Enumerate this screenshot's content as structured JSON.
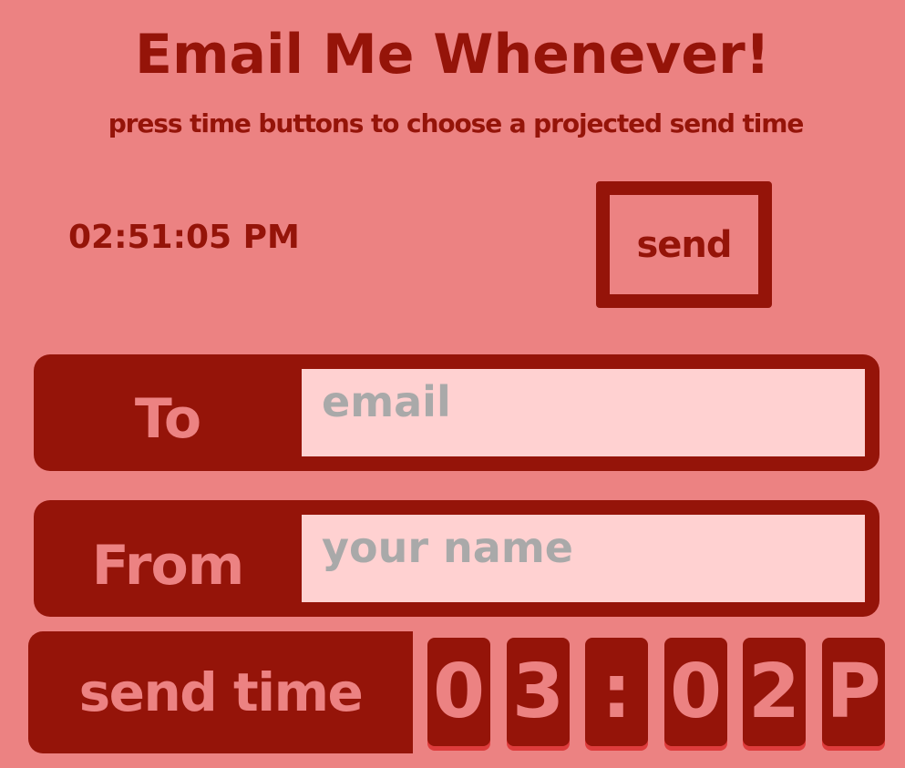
{
  "title": "Email Me Whenever!",
  "subtitle": "press time buttons to choose a projected send time",
  "clock": "02:51:05 PM",
  "send_label": "send",
  "to_field": {
    "label": "To",
    "placeholder": "email",
    "value": ""
  },
  "from_field": {
    "label": "From",
    "placeholder": "your name",
    "value": ""
  },
  "send_time": {
    "label": "send time",
    "digits": [
      "0",
      "3",
      ":",
      "0",
      "2",
      "P"
    ]
  },
  "colors": {
    "background": "#ec8282",
    "primary": "#951409",
    "input_bg": "#ffd1d1",
    "placeholder": "#a9a9a9",
    "digit_shadow": "#de3c3c"
  }
}
